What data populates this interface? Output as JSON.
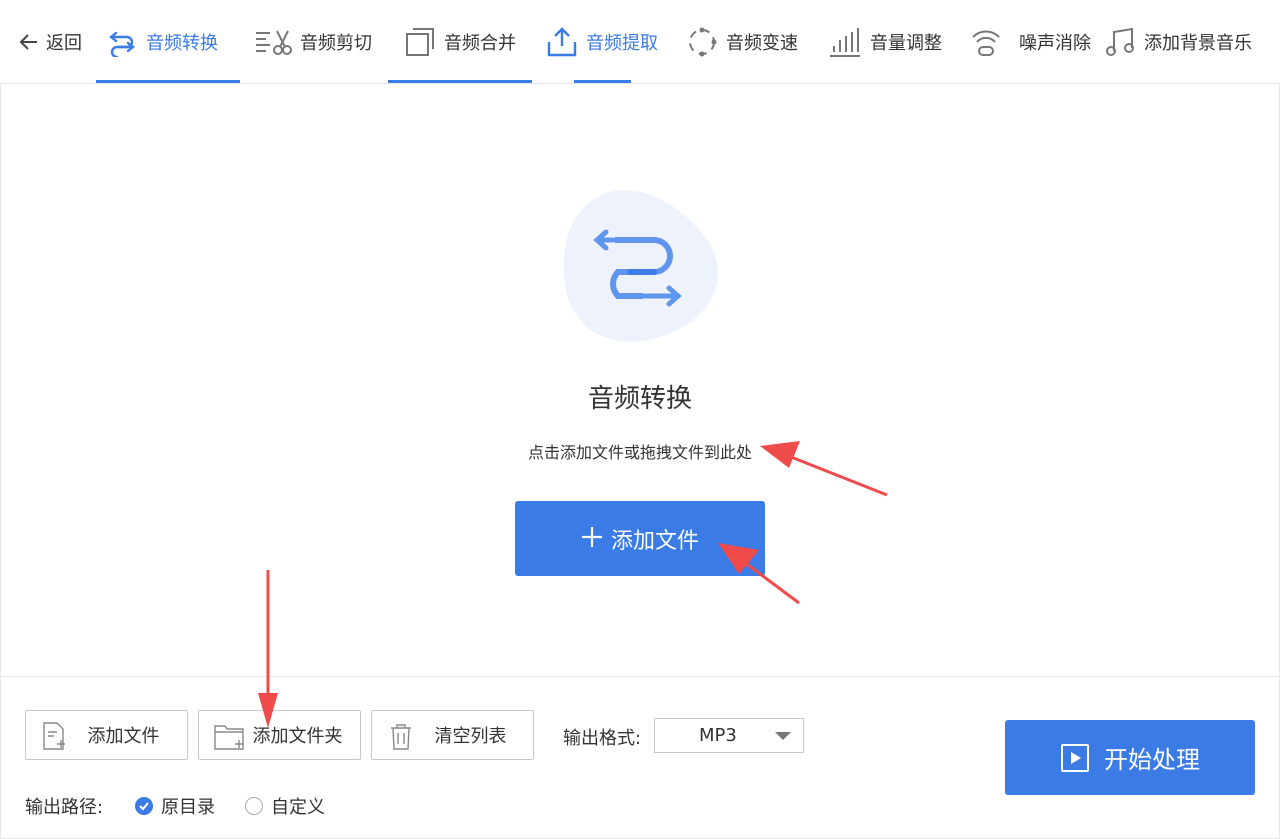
{
  "nav": {
    "back_label": "返回",
    "tabs": [
      {
        "label": "音频转换",
        "icon": "convert-icon",
        "active": true
      },
      {
        "label": "音频剪切",
        "icon": "scissors-icon",
        "active": false
      },
      {
        "label": "音频合并",
        "icon": "merge-icon",
        "active": false
      },
      {
        "label": "音频提取",
        "icon": "upload-icon",
        "active": true
      },
      {
        "label": "音频变速",
        "icon": "speed-icon",
        "active": false
      },
      {
        "label": "音量调整",
        "icon": "volume-bars-icon",
        "active": false
      },
      {
        "label": "噪声消除",
        "icon": "noise-icon",
        "active": false
      },
      {
        "label": "添加背景音乐",
        "icon": "music-note-icon",
        "active": false
      }
    ]
  },
  "main": {
    "title": "音频转换",
    "subtitle": "点击添加文件或拖拽文件到此处",
    "add_button": "添加文件"
  },
  "footer": {
    "add_file": "添加文件",
    "add_folder": "添加文件夹",
    "clear_list": "清空列表",
    "format_label": "输出格式:",
    "format_value": "MP3",
    "path_label": "输出路径:",
    "path_options": [
      {
        "label": "原目录",
        "checked": true
      },
      {
        "label": "自定义",
        "checked": false
      }
    ],
    "start_button": "开始处理"
  },
  "colors": {
    "accent": "#3a7be6",
    "annotation_arrow": "#f04b4b"
  }
}
